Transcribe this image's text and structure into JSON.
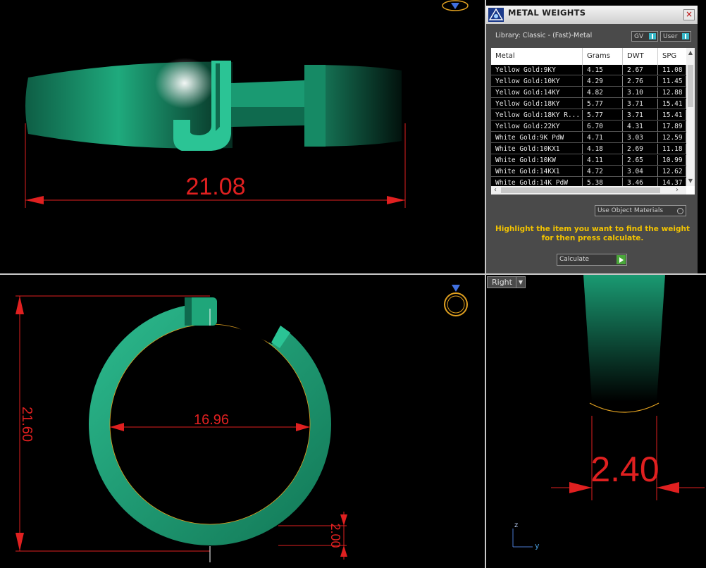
{
  "viewport_top": {
    "dimension": "21.08"
  },
  "viewport_bottom_left": {
    "outer_dimension": "21.60",
    "inner_dimension": "16.96",
    "thickness_dimension": "2.00"
  },
  "viewport_right": {
    "view_label": "Right",
    "dimension": "2.40",
    "axis_z": "z",
    "axis_y": "y"
  },
  "panel": {
    "title": "METAL WEIGHTS",
    "close": "×",
    "library": "Library: Classic - (Fast)-Metal",
    "gv_label": "GV",
    "user_label": "User",
    "columns": [
      "Metal",
      "Grams",
      "DWT",
      "SPG"
    ],
    "rows": [
      [
        "Yellow Gold:9KY",
        "4.15",
        "2.67",
        "11.08"
      ],
      [
        "Yellow Gold:10KY",
        "4.29",
        "2.76",
        "11.45"
      ],
      [
        "Yellow Gold:14KY",
        "4.82",
        "3.10",
        "12.88"
      ],
      [
        "Yellow Gold:18KY",
        "5.77",
        "3.71",
        "15.41"
      ],
      [
        "Yellow Gold:18KY R...",
        "5.77",
        "3.71",
        "15.41"
      ],
      [
        "Yellow Gold:22KY",
        "6.70",
        "4.31",
        "17.89"
      ],
      [
        "White Gold:9K PdW",
        "4.71",
        "3.03",
        "12.59"
      ],
      [
        "White Gold:10KX1",
        "4.18",
        "2.69",
        "11.18"
      ],
      [
        "White Gold:10KW",
        "4.11",
        "2.65",
        "10.99"
      ],
      [
        "White Gold:14KX1",
        "4.72",
        "3.04",
        "12.62"
      ],
      [
        "White Gold:14K PdW",
        "5.38",
        "3.46",
        "14.37"
      ]
    ],
    "use_object_materials": "Use Object Materials",
    "hint": "Highlight the item you want to find the weight for then press calculate.",
    "calculate": "Calculate"
  },
  "colors": {
    "ring": "#1fa67a",
    "dimension": "#e02020",
    "hint": "#f2c300",
    "accent": "#38b8c8"
  }
}
